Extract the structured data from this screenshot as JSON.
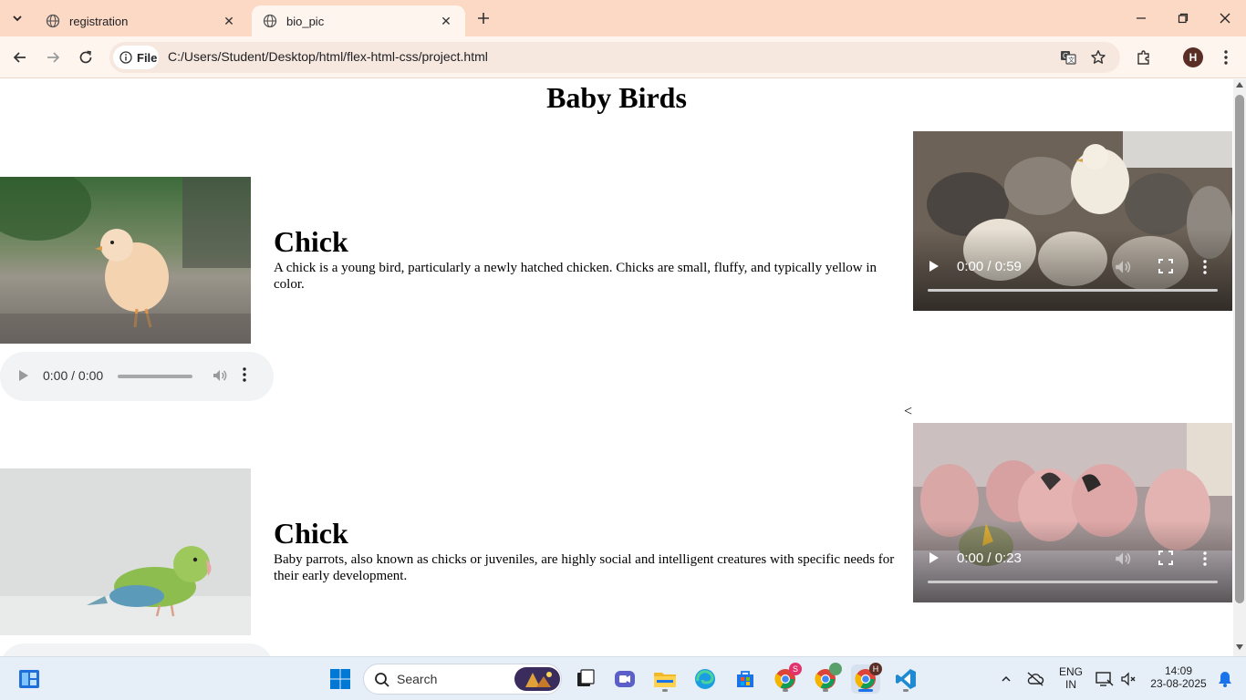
{
  "browser": {
    "tabs": [
      {
        "title": "registration",
        "active": false
      },
      {
        "title": "bio_pic",
        "active": true
      }
    ],
    "site_chip_label": "File",
    "url": "C:/Users/Student/Desktop/html/flex-html-css/project.html",
    "profile_initial": "H"
  },
  "page": {
    "title": "Baby Birds",
    "sections": [
      {
        "heading": "Chick",
        "text": "A chick is a young bird, particularly a newly hatched chicken. Chicks are small, fluffy, and typically yellow in color.",
        "audio_time": "0:00 / 0:00",
        "video_time": "0:00 / 0:59"
      },
      {
        "heading": "Chick",
        "text": "Baby parrots, also known as chicks or juveniles, are highly social and intelligent creatures with specific needs for their early development.",
        "video_time": "0:00 / 0:23"
      }
    ],
    "stray_text": "<"
  },
  "taskbar": {
    "search_label": "Search",
    "language_top": "ENG",
    "language_bottom": "IN",
    "time": "14:09",
    "date": "23-08-2025",
    "chrome_badge_1": "S",
    "chrome_badge_3": "H"
  }
}
